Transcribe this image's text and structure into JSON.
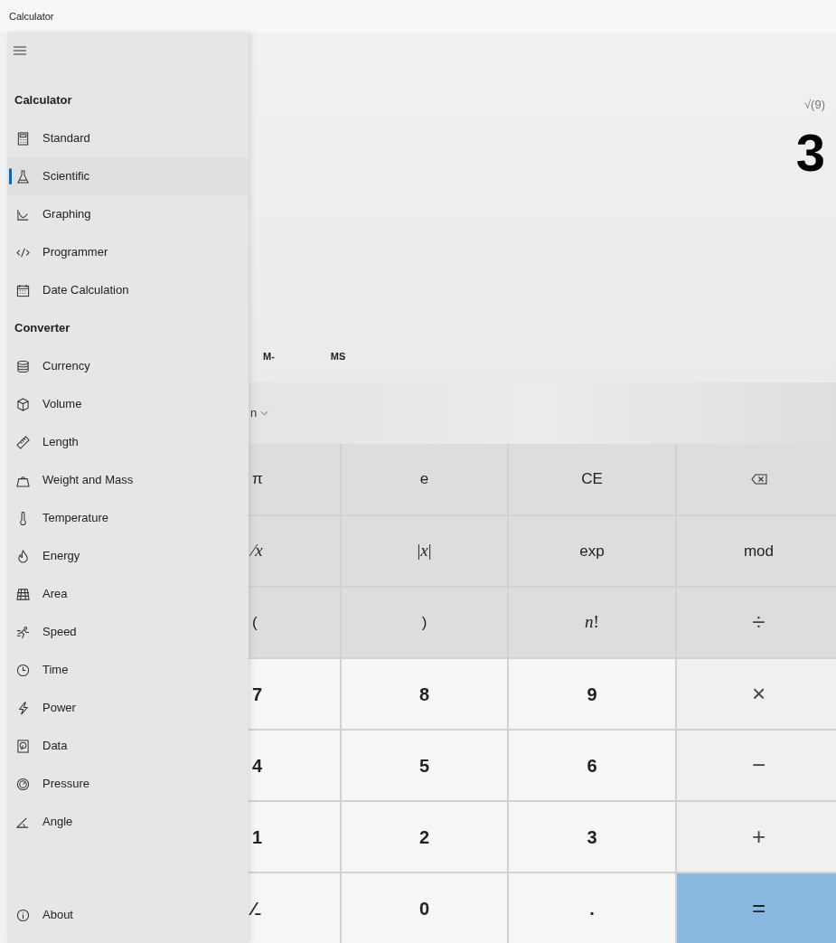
{
  "window": {
    "title": "Calculator"
  },
  "display": {
    "expression": "√(9)",
    "result": "3"
  },
  "memory_buttons": [
    "M-",
    "MS"
  ],
  "mode_dropdown": {
    "label": "n"
  },
  "keypad": [
    [
      {
        "label": "π",
        "kind": "function"
      },
      {
        "label": "e",
        "kind": "function"
      },
      {
        "label": "CE",
        "kind": "function"
      },
      {
        "kind": "backspace"
      }
    ],
    [
      {
        "label": "⁄*x*",
        "kind": "math"
      },
      {
        "label": "|*x*|",
        "kind": "math"
      },
      {
        "label": "exp",
        "kind": "function"
      },
      {
        "label": "mod",
        "kind": "function"
      }
    ],
    [
      {
        "label": "(",
        "kind": "function"
      },
      {
        "label": ")",
        "kind": "function"
      },
      {
        "label": "*n*!",
        "kind": "math"
      },
      {
        "label": "÷",
        "kind": "function_operator"
      }
    ],
    [
      {
        "label": "7",
        "kind": "number"
      },
      {
        "label": "8",
        "kind": "number"
      },
      {
        "label": "9",
        "kind": "number"
      },
      {
        "label": "×",
        "kind": "operator"
      }
    ],
    [
      {
        "label": "4",
        "kind": "number"
      },
      {
        "label": "5",
        "kind": "number"
      },
      {
        "label": "6",
        "kind": "number"
      },
      {
        "label": "−",
        "kind": "operator"
      }
    ],
    [
      {
        "label": "1",
        "kind": "number"
      },
      {
        "label": "2",
        "kind": "number"
      },
      {
        "label": "3",
        "kind": "number"
      },
      {
        "label": "+",
        "kind": "operator"
      }
    ],
    [
      {
        "label": "⁄₋",
        "kind": "number"
      },
      {
        "label": "0",
        "kind": "number"
      },
      {
        "label": ".",
        "kind": "number"
      },
      {
        "label": "=",
        "kind": "equals"
      }
    ]
  ],
  "sidebar": {
    "sections": [
      {
        "heading": "Calculator",
        "items": [
          {
            "label": "Standard",
            "selected": false
          },
          {
            "label": "Scientific",
            "selected": true
          },
          {
            "label": "Graphing",
            "selected": false
          },
          {
            "label": "Programmer",
            "selected": false
          },
          {
            "label": "Date Calculation",
            "selected": false
          }
        ]
      },
      {
        "heading": "Converter",
        "items": [
          {
            "label": "Currency",
            "selected": false
          },
          {
            "label": "Volume",
            "selected": false
          },
          {
            "label": "Length",
            "selected": false
          },
          {
            "label": "Weight and Mass",
            "selected": false
          },
          {
            "label": "Temperature",
            "selected": false
          },
          {
            "label": "Energy",
            "selected": false
          },
          {
            "label": "Area",
            "selected": false
          },
          {
            "label": "Speed",
            "selected": false
          },
          {
            "label": "Time",
            "selected": false
          },
          {
            "label": "Power",
            "selected": false
          },
          {
            "label": "Data",
            "selected": false
          },
          {
            "label": "Pressure",
            "selected": false
          },
          {
            "label": "Angle",
            "selected": false
          }
        ]
      }
    ],
    "footer_item": {
      "label": "About"
    }
  }
}
